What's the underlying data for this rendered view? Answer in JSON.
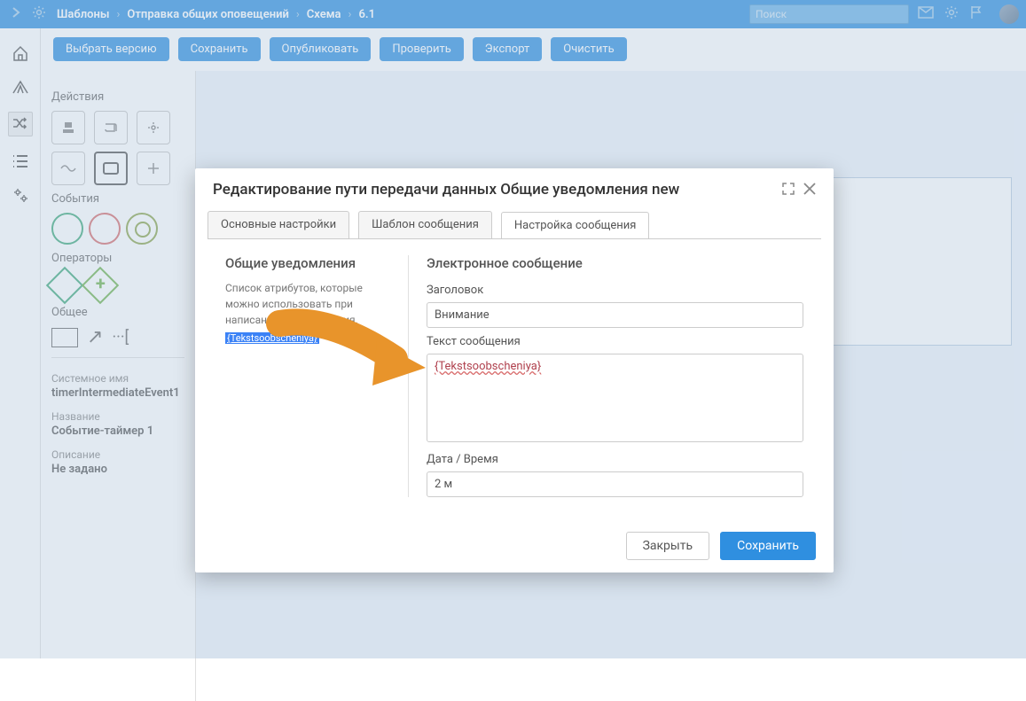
{
  "topbar": {
    "breadcrumb": [
      "Шаблоны",
      "Отправка общих оповещений",
      "Схема",
      "6.1"
    ],
    "search_placeholder": "Поиск"
  },
  "toolbar": {
    "b1": "Выбрать версию",
    "b2": "Сохранить",
    "b3": "Опубликовать",
    "b4": "Проверить",
    "b5": "Экспорт",
    "b6": "Очистить"
  },
  "sidepanel": {
    "actions": "Действия",
    "events": "События",
    "operators": "Операторы",
    "general": "Общее"
  },
  "props": {
    "sys_label": "Системное имя",
    "sys_val": "timerIntermediateEvent1",
    "name_label": "Название",
    "name_val": "Событие-таймер 1",
    "desc_label": "Описание",
    "desc_val": "Не задано"
  },
  "modal": {
    "title": "Редактирование пути передачи данных Общие уведомления new",
    "tabs": {
      "t1": "Основные настройки",
      "t2": "Шаблон сообщения",
      "t3": "Настройка сообщения"
    },
    "left_heading": "Общие уведомления",
    "left_desc": "Список атрибутов, которые можно использовать при написании эл. сообщения.",
    "token": "{Tekstsoobscheniya}",
    "right_heading": "Электронное сообщение",
    "f_header": "Заголовок",
    "f_header_val": "Внимание",
    "f_body": "Текст сообщения",
    "f_body_val": "{Tekstsoobscheniya}",
    "f_date": "Дата / Время",
    "f_date_val": "2 м",
    "close": "Закрыть",
    "save": "Сохранить"
  }
}
